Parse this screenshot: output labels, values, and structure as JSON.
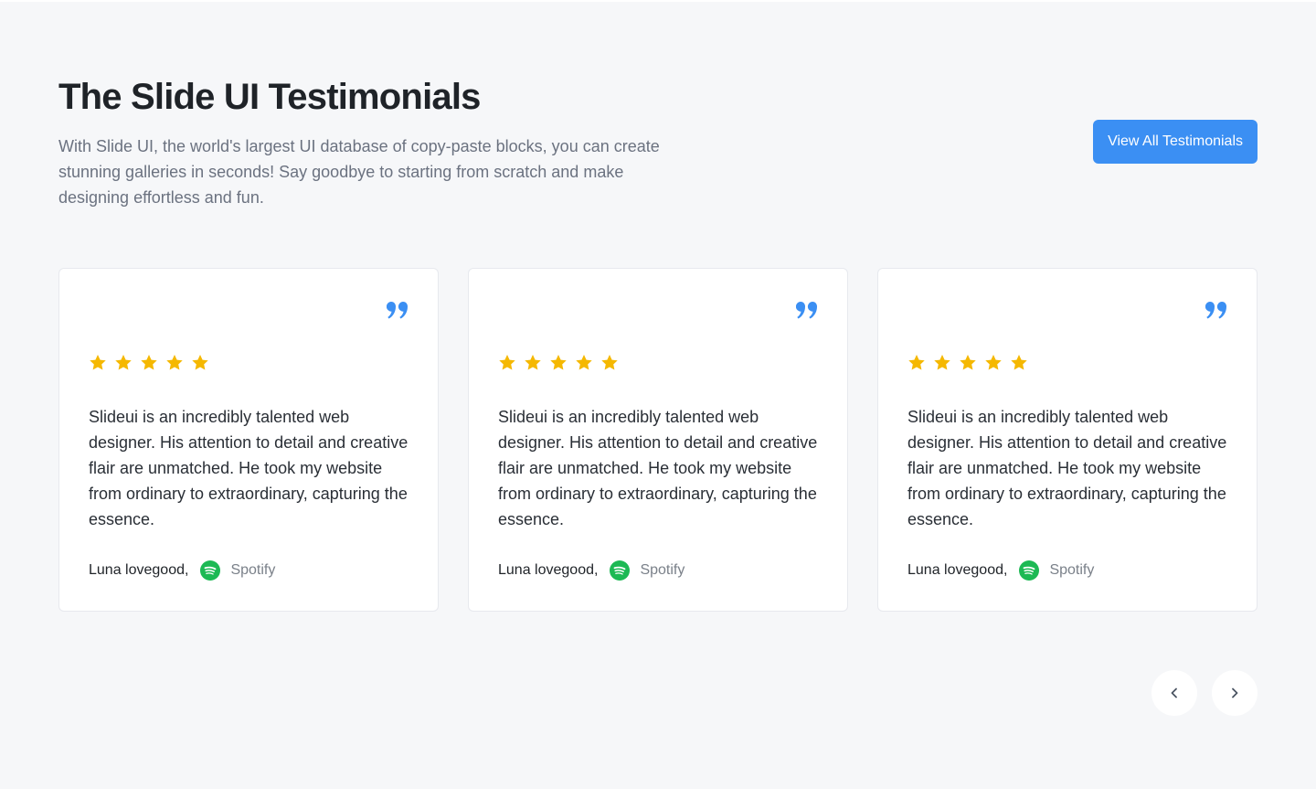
{
  "header": {
    "title": "The Slide UI Testimonials",
    "subtitle": "With Slide UI, the world's largest UI database of copy-paste blocks, you can create stunning galleries in seconds! Say goodbye to starting from scratch and make designing effortless and fun.",
    "cta_label": "View All Testimonials"
  },
  "colors": {
    "accent": "#3b8ff3",
    "star": "#f5b800",
    "spotify": "#1db954",
    "background": "#f6f7f9"
  },
  "testimonials": [
    {
      "rating": 5,
      "text": "Slideui is an incredibly talented web designer. His attention to detail and creative flair are unmatched. He took my website from ordinary to extraordinary, capturing the essence.",
      "author": "Luna lovegood,",
      "company": "Spotify",
      "company_icon": "spotify-icon"
    },
    {
      "rating": 5,
      "text": "Slideui is an incredibly talented web designer. His attention to detail and creative flair are unmatched. He took my website from ordinary to extraordinary, capturing the essence.",
      "author": "Luna lovegood,",
      "company": "Spotify",
      "company_icon": "spotify-icon"
    },
    {
      "rating": 5,
      "text": "Slideui is an incredibly talented web designer. His attention to detail and creative flair are unmatched. He took my website from ordinary to extraordinary, capturing the essence.",
      "author": "Luna lovegood,",
      "company": "Spotify",
      "company_icon": "spotify-icon"
    }
  ],
  "navigation": {
    "prev_icon": "chevron-left-icon",
    "next_icon": "chevron-right-icon"
  }
}
